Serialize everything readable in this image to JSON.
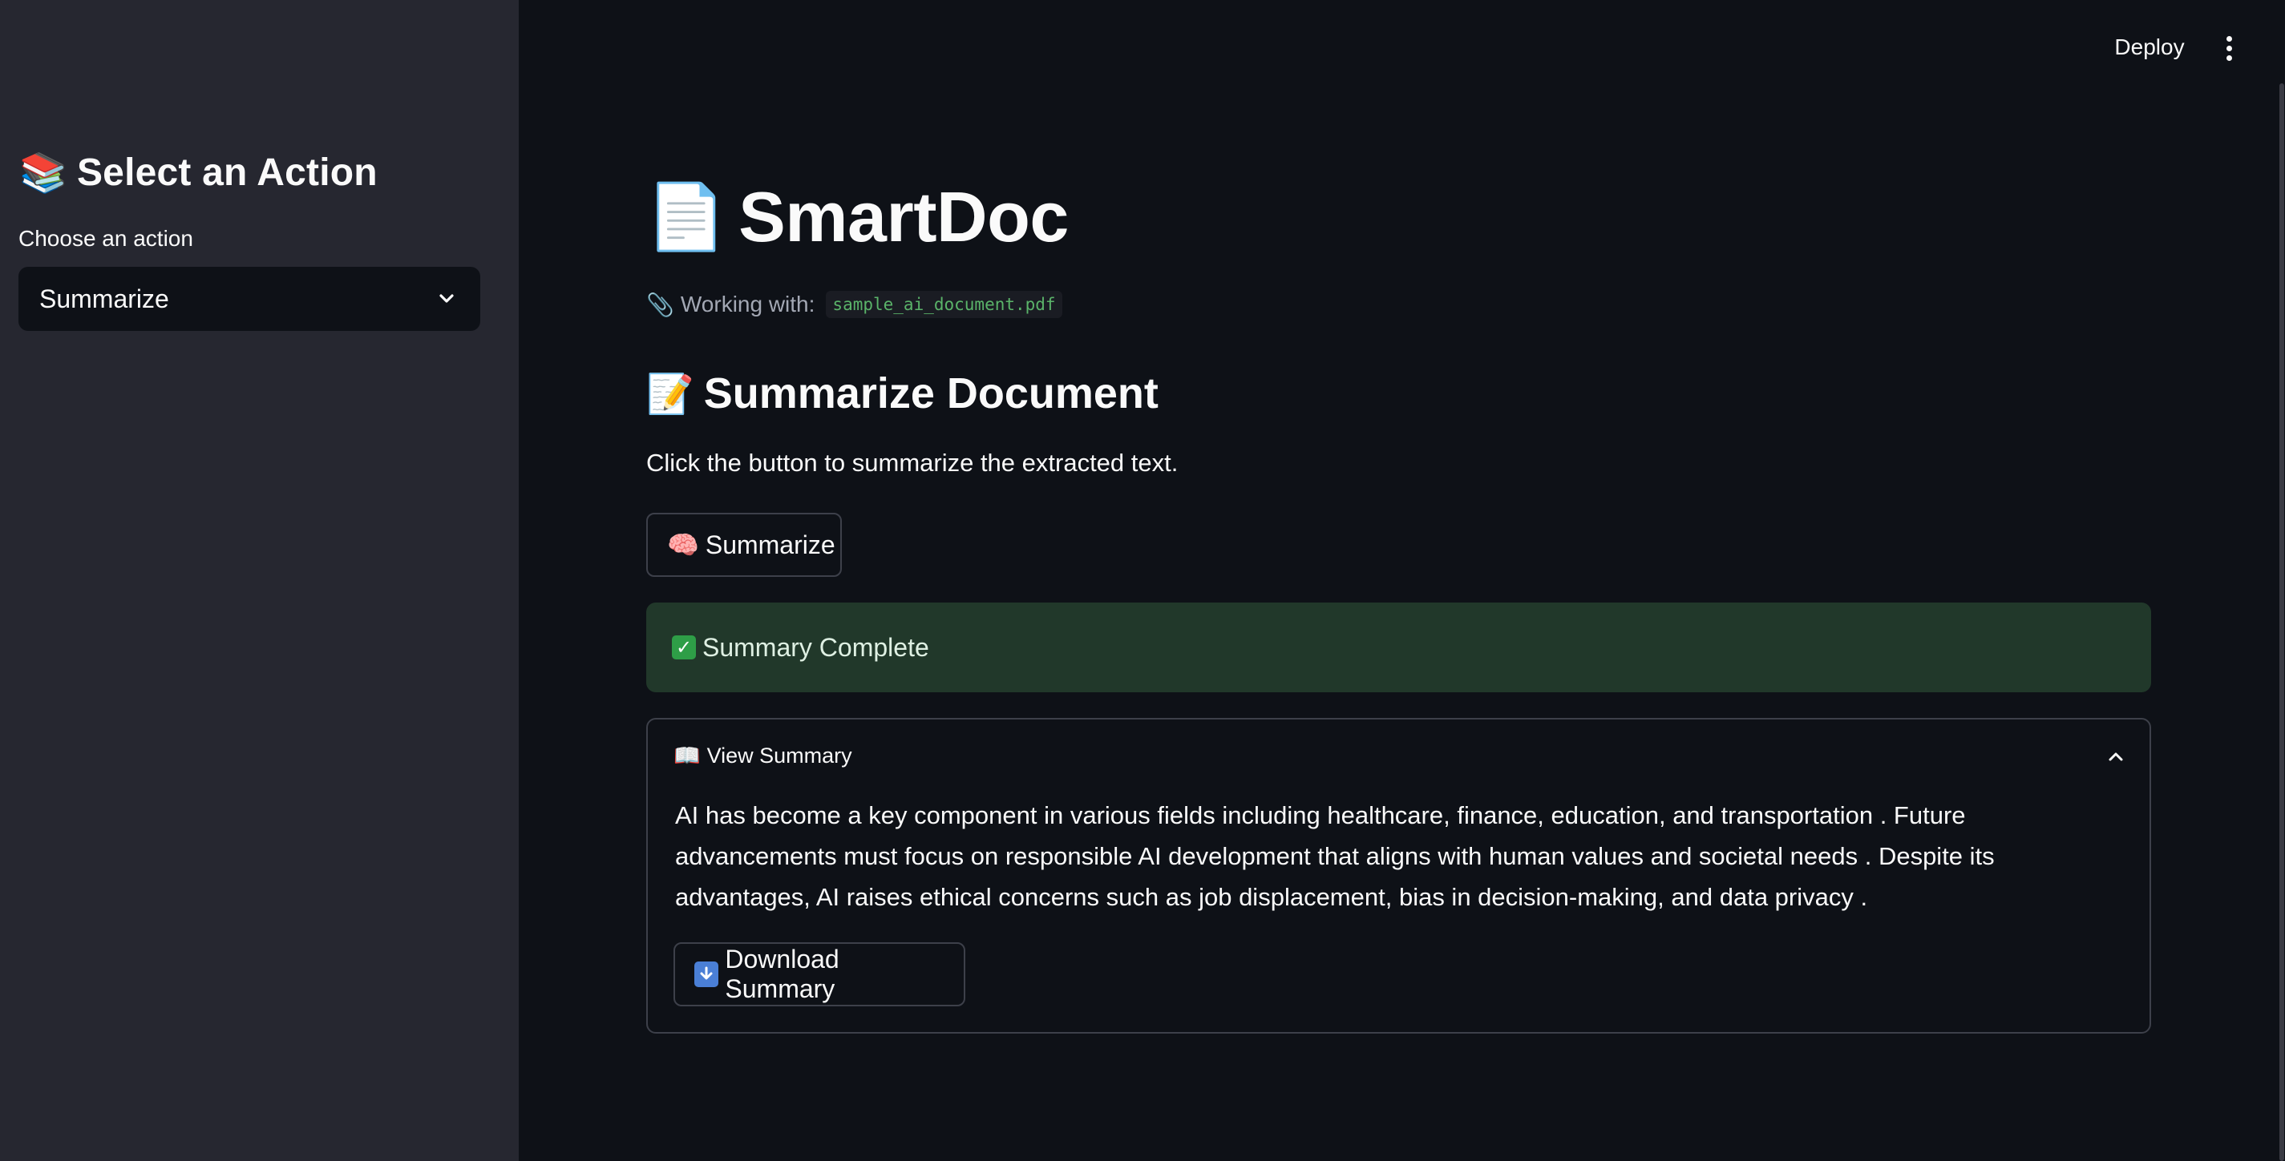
{
  "sidebar": {
    "title_icon": "books-emoji",
    "title_emoji": "📚",
    "title": "Select an Action",
    "select_label": "Choose an action",
    "select_value": "Summarize"
  },
  "header": {
    "deploy_label": "Deploy",
    "menu_icon": "kebab-menu-icon"
  },
  "main": {
    "title_emoji": "📄",
    "title": "SmartDoc",
    "working_emoji": "📎",
    "working_label": "Working with:",
    "file_name": "sample_ai_document.pdf",
    "section_emoji": "📝",
    "section_title": "Summarize Document",
    "instruction": "Click the button to summarize the extracted text.",
    "summarize_emoji": "🧠",
    "summarize_label": "Summarize",
    "success_text": "Summary Complete",
    "expander": {
      "icon_emoji": "📖",
      "label": "View Summary",
      "expanded": true,
      "summary": "AI has become a key component in various fields including healthcare, finance, education, and transportation . Future advancements must focus on responsible AI development that aligns with human values and societal needs . Despite its advantages, AI raises ethical concerns such as job displacement, bias in decision-making, and data privacy .",
      "download_label": "Download Summary"
    }
  },
  "colors": {
    "background": "#0e1117",
    "sidebar": "#262730",
    "success_bg": "#21382a",
    "code_text": "#5ab369",
    "border": "#3d404a"
  }
}
